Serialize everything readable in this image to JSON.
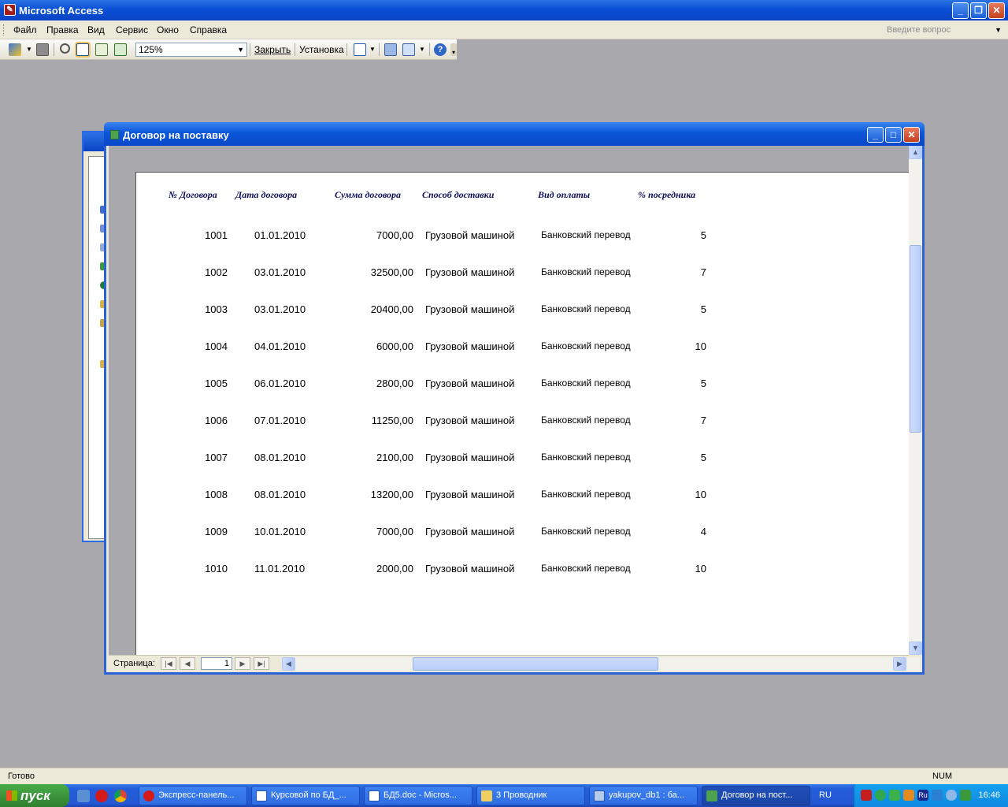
{
  "app": {
    "title": "Microsoft Access"
  },
  "menu": [
    "Файл",
    "Правка",
    "Вид",
    "Сервис",
    "Окно",
    "Справка"
  ],
  "ask_placeholder": "Введите вопрос",
  "toolbar": {
    "zoom": "125%",
    "close_label": "Закрыть",
    "setup_label": "Установка"
  },
  "report": {
    "title": "Договор на поставку",
    "columns": [
      "№ Договора",
      "Дата договора",
      "Сумма договора",
      "Способ доставки",
      "Вид оплаты",
      "% посредника"
    ],
    "rows": [
      [
        "1001",
        "01.01.2010",
        "7000,00",
        "Грузовой машиной",
        "Банковский перевод",
        "5"
      ],
      [
        "1002",
        "03.01.2010",
        "32500,00",
        "Грузовой машиной",
        "Банковский перевод",
        "7"
      ],
      [
        "1003",
        "03.01.2010",
        "20400,00",
        "Грузовой машиной",
        "Банковский перевод",
        "5"
      ],
      [
        "1004",
        "04.01.2010",
        "6000,00",
        "Грузовой машиной",
        "Банковский перевод",
        "10"
      ],
      [
        "1005",
        "06.01.2010",
        "2800,00",
        "Грузовой машиной",
        "Банковский перевод",
        "5"
      ],
      [
        "1006",
        "07.01.2010",
        "11250,00",
        "Грузовой машиной",
        "Банковский перевод",
        "7"
      ],
      [
        "1007",
        "08.01.2010",
        "2100,00",
        "Грузовой машиной",
        "Банковский перевод",
        "5"
      ],
      [
        "1008",
        "08.01.2010",
        "13200,00",
        "Грузовой машиной",
        "Банковский перевод",
        "10"
      ],
      [
        "1009",
        "10.01.2010",
        "7000,00",
        "Грузовой машиной",
        "Банковский перевод",
        "4"
      ],
      [
        "1010",
        "11.01.2010",
        "2000,00",
        "Грузовой машиной",
        "Банковский перевод",
        "10"
      ]
    ]
  },
  "nav": {
    "label": "Страница:",
    "page": "1"
  },
  "status": {
    "text": "Готово",
    "num": "NUM"
  },
  "taskbar": {
    "start": "пуск",
    "tasks": [
      "Экспресс-панель...",
      "Курсовой по БД_...",
      "БД5.doc - Micros...",
      "3 Проводник",
      "yakupov_db1 : ба...",
      "Договор на пост..."
    ],
    "lang": "RU",
    "clock": "16:46"
  },
  "colors": {
    "titlebar": "#0a4fd6",
    "desktop": "#a9a9ad",
    "header_text": "#10105a",
    "taskbar": "#245edb",
    "start": "#3c953c"
  }
}
